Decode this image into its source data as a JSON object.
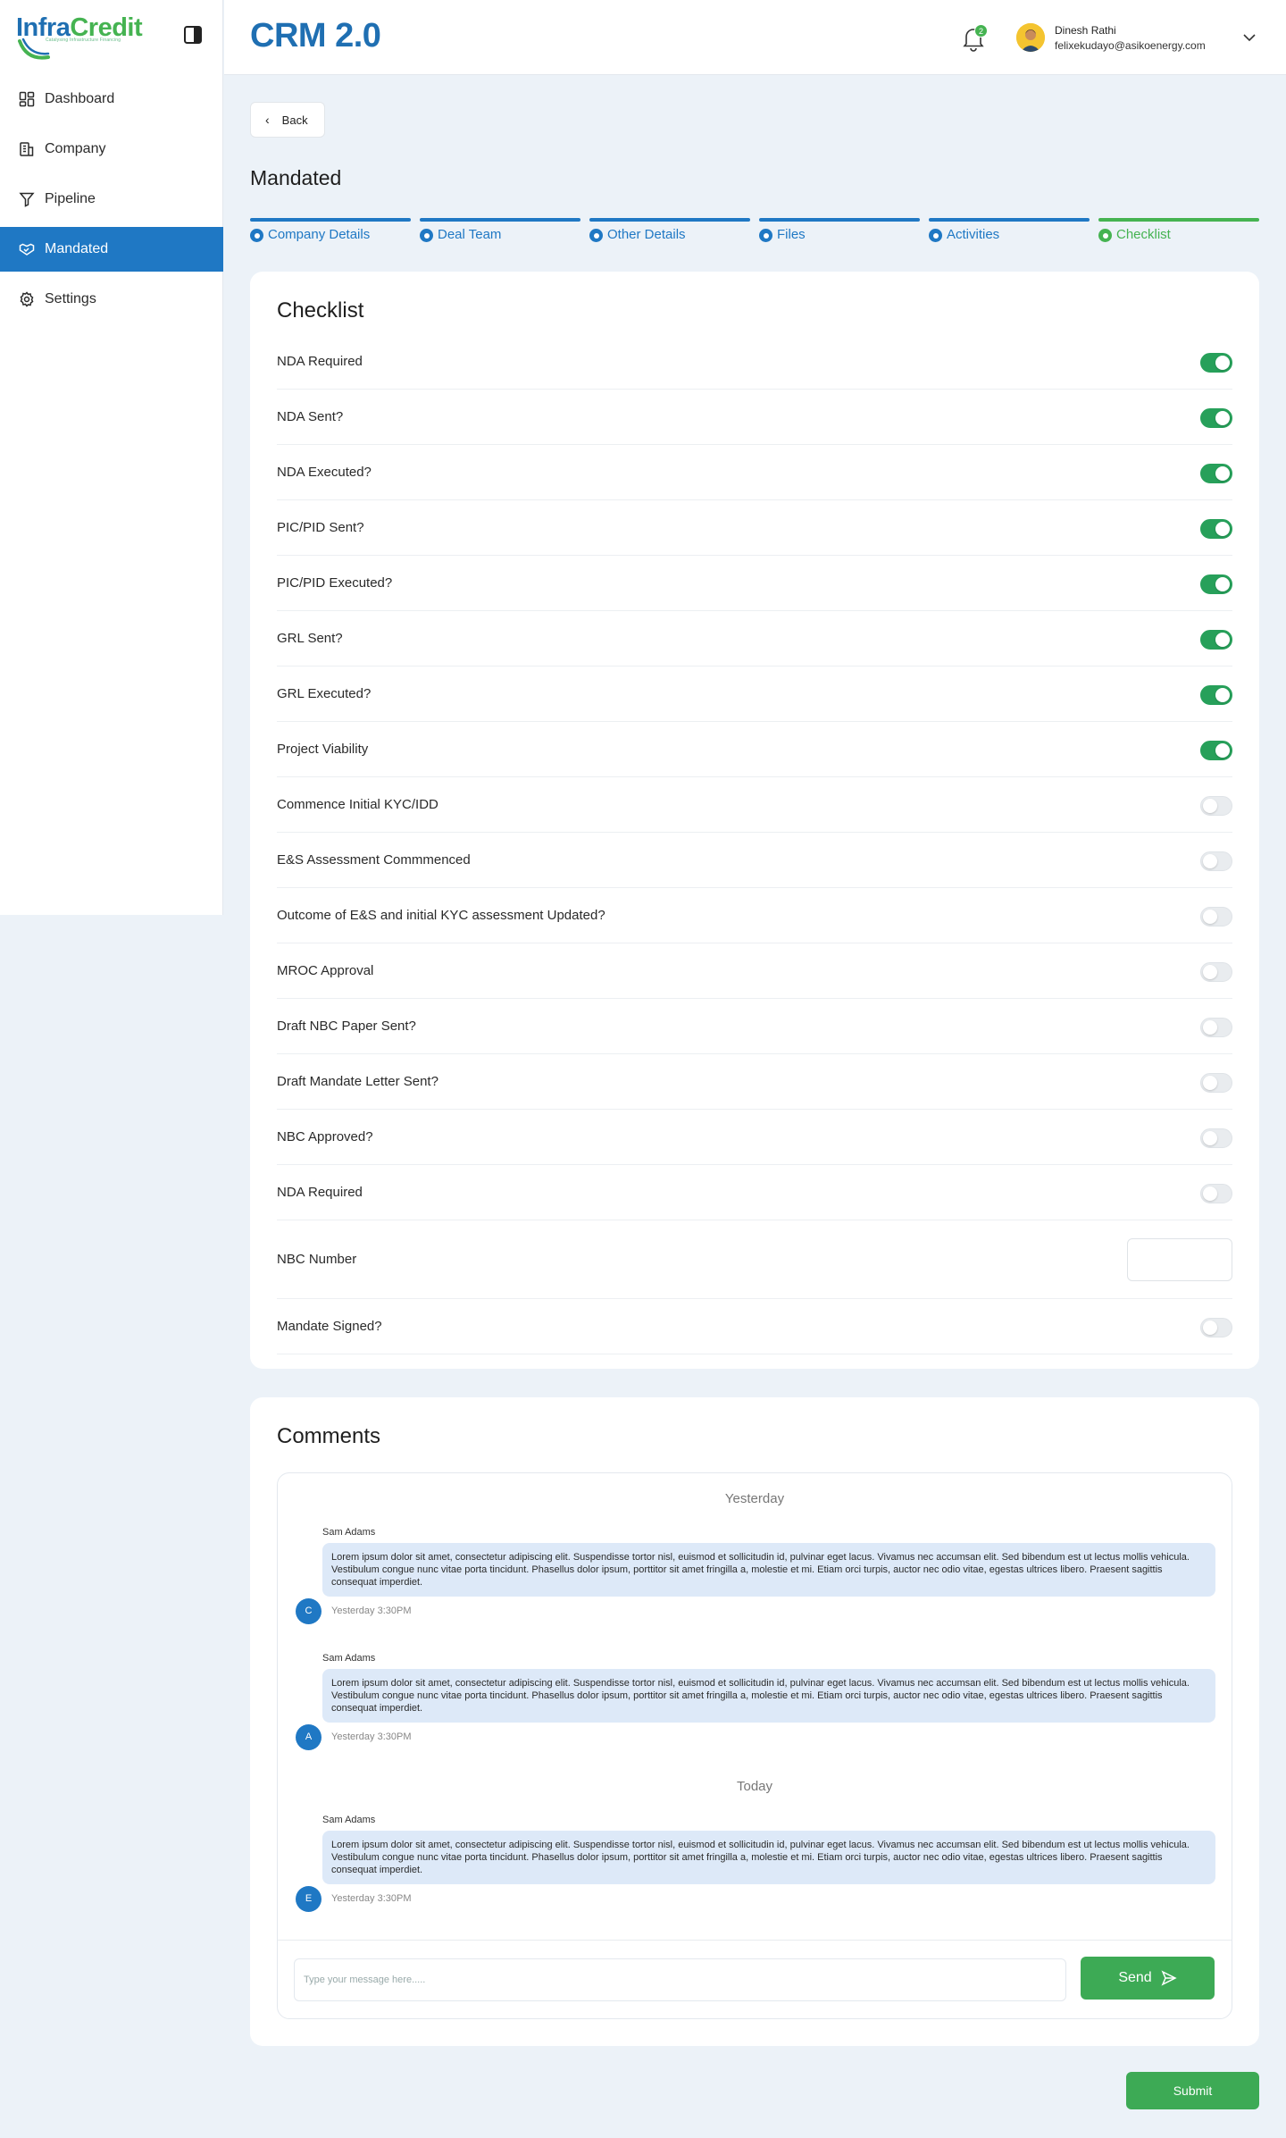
{
  "brand": {
    "logo_left": "Infra",
    "logo_right": "Credit",
    "logo_tagline": "Catalysing Infrastructure Financing"
  },
  "sidebar": {
    "items": [
      {
        "label": "Dashboard",
        "icon": "dashboard-icon"
      },
      {
        "label": "Company",
        "icon": "building-icon"
      },
      {
        "label": "Pipeline",
        "icon": "funnel-icon"
      },
      {
        "label": "Mandated",
        "icon": "handshake-icon",
        "active": true
      },
      {
        "label": "Settings",
        "icon": "gear-icon"
      }
    ]
  },
  "header": {
    "app_title": "CRM 2.0",
    "notification_count": "2",
    "user_name": "Dinesh Rathi",
    "user_email": "felixekudayo@asikoenergy.com"
  },
  "main": {
    "back_label": "Back",
    "page_title": "Mandated",
    "steps": [
      {
        "label": "Company Details",
        "state": "complete"
      },
      {
        "label": "Deal Team",
        "state": "complete"
      },
      {
        "label": "Other Details",
        "state": "complete"
      },
      {
        "label": "Files",
        "state": "complete"
      },
      {
        "label": "Activities",
        "state": "complete"
      },
      {
        "label": "Checklist",
        "state": "current"
      }
    ]
  },
  "checklist": {
    "title": "Checklist",
    "items": [
      {
        "label": "NDA Required",
        "on": true
      },
      {
        "label": "NDA Sent?",
        "on": true
      },
      {
        "label": "NDA Executed?",
        "on": true
      },
      {
        "label": "PIC/PID Sent?",
        "on": true
      },
      {
        "label": "PIC/PID Executed?",
        "on": true
      },
      {
        "label": "GRL Sent?",
        "on": true
      },
      {
        "label": "GRL Executed?",
        "on": true
      },
      {
        "label": "Project Viability",
        "on": true
      },
      {
        "label": "Commence Initial KYC/IDD",
        "on": false
      },
      {
        "label": "E&S Assessment Commmenced",
        "on": false
      },
      {
        "label": "Outcome of E&S and initial KYC assessment Updated?",
        "on": false
      },
      {
        "label": "MROC Approval",
        "on": false
      },
      {
        "label": "Draft NBC Paper Sent?",
        "on": false
      },
      {
        "label": "Draft Mandate Letter Sent?",
        "on": false
      },
      {
        "label": "NBC Approved?",
        "on": false
      },
      {
        "label": "NDA Required",
        "on": false
      }
    ],
    "nbc_number_label": "NBC Number",
    "nbc_number_value": "",
    "mandate_signed_label": "Mandate Signed?",
    "mandate_signed_on": false
  },
  "comments": {
    "title": "Comments",
    "day_yesterday": "Yesterday",
    "day_today": "Today",
    "entries": [
      {
        "author": "Sam Adams",
        "initial": "C",
        "time": "Yesterday 3:30PM",
        "text": "Lorem ipsum dolor sit amet, consectetur adipiscing elit. Suspendisse tortor nisl, euismod et sollicitudin id, pulvinar eget lacus. Vivamus nec accumsan elit. Sed bibendum est ut lectus mollis vehicula. Vestibulum congue nunc vitae porta tincidunt. Phasellus dolor ipsum, porttitor sit amet fringilla a, molestie et mi. Etiam orci turpis, auctor nec odio vitae, egestas ultrices libero. Praesent sagittis consequat imperdiet."
      },
      {
        "author": "Sam Adams",
        "initial": "A",
        "time": "Yesterday 3:30PM",
        "text": "Lorem ipsum dolor sit amet, consectetur adipiscing elit. Suspendisse tortor nisl, euismod et sollicitudin id, pulvinar eget lacus. Vivamus nec accumsan elit. Sed bibendum est ut lectus mollis vehicula. Vestibulum congue nunc vitae porta tincidunt. Phasellus dolor ipsum, porttitor sit amet fringilla a, molestie et mi. Etiam orci turpis, auctor nec odio vitae, egestas ultrices libero. Praesent sagittis consequat imperdiet."
      },
      {
        "author": "Sam Adams",
        "initial": "E",
        "time": "Yesterday 3:30PM",
        "text": "Lorem ipsum dolor sit amet, consectetur adipiscing elit. Suspendisse tortor nisl, euismod et sollicitudin id, pulvinar eget lacus. Vivamus nec accumsan elit. Sed bibendum est ut lectus mollis vehicula. Vestibulum congue nunc vitae porta tincidunt. Phasellus dolor ipsum, porttitor sit amet fringilla a, molestie et mi. Etiam orci turpis, auctor nec odio vitae, egestas ultrices libero. Praesent sagittis consequat imperdiet."
      }
    ],
    "input_placeholder": "Type your message here.....",
    "send_label": "Send"
  },
  "submit_label": "Submit",
  "colors": {
    "primary": "#1f78c4",
    "success": "#45b351",
    "toggle_on": "#27a05a",
    "bubble": "#dde9f8",
    "page_bg": "#ecf2f8"
  }
}
